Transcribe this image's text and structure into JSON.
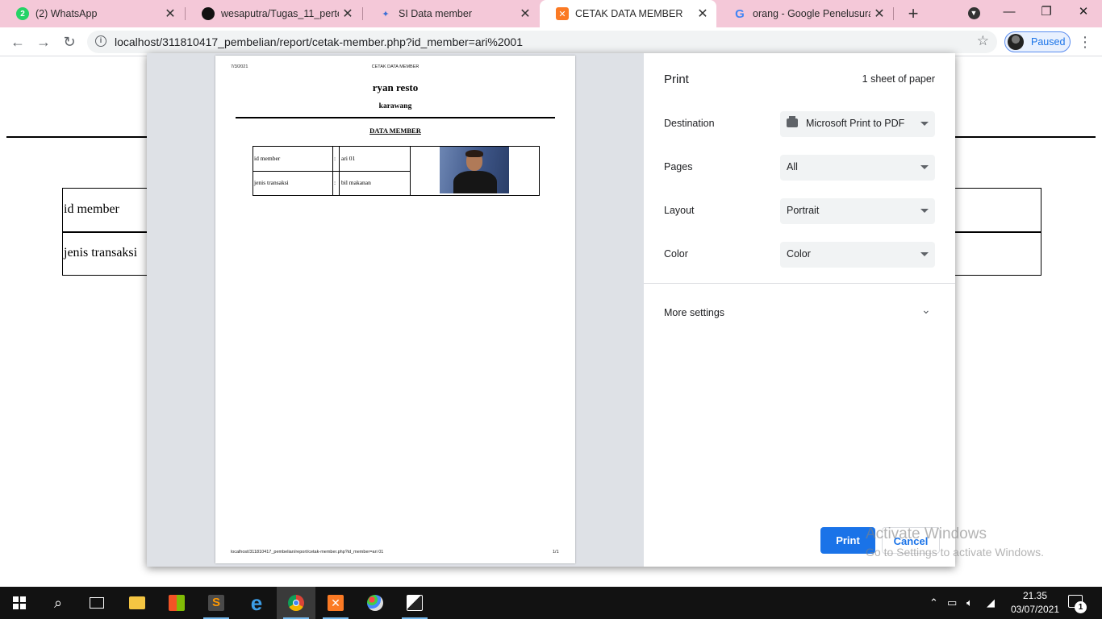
{
  "browser": {
    "tabs": [
      {
        "title": "(2) WhatsApp",
        "icon": "whatsapp-icon",
        "badge": "2"
      },
      {
        "title": "wesaputra/Tugas_11_pertemuan",
        "icon": "github-icon"
      },
      {
        "title": "SI Data member",
        "icon": "site-icon"
      },
      {
        "title": "CETAK DATA MEMBER",
        "icon": "xampp-icon",
        "active": true
      },
      {
        "title": "orang - Google Penelusuran",
        "icon": "google-icon"
      }
    ],
    "new_tab_symbol": "+",
    "url": "localhost/311810417_pembelian/report/cetak-member.php?id_member=ari%2001",
    "profile_status": "Paused"
  },
  "background_page": {
    "rows": [
      {
        "label": "id member"
      },
      {
        "label": "jenis transaksi"
      }
    ]
  },
  "print_preview": {
    "date": "7/3/2021",
    "header_title": "CETAK DATA MEMBER",
    "org_name": "ryan resto",
    "org_city": "karawang",
    "section_title": "DATA MEMBER",
    "rows": [
      {
        "label": "id member",
        "sep": ":",
        "value": "ari 01"
      },
      {
        "label": "jenis transaksi",
        "sep": ":",
        "value": "bil makanan"
      }
    ],
    "footer_url": "localhost/311810417_pembelian/report/cetak-member.php?id_member=ari 01",
    "page_num": "1/1"
  },
  "print_settings": {
    "title": "Print",
    "sheet_count": "1 sheet of paper",
    "destination": {
      "label": "Destination",
      "value": "Microsoft Print to PDF"
    },
    "pages": {
      "label": "Pages",
      "value": "All"
    },
    "layout": {
      "label": "Layout",
      "value": "Portrait"
    },
    "color": {
      "label": "Color",
      "value": "Color"
    },
    "more_settings": "More settings",
    "print_button": "Print",
    "cancel_button": "Cancel"
  },
  "watermark": {
    "line1": "Activate Windows",
    "line2": "Go to Settings to activate Windows."
  },
  "taskbar": {
    "time": "21.35",
    "date": "03/07/2021",
    "notification_count": "1"
  },
  "colors": {
    "tab_strip": "#f4c8d8",
    "accent": "#1a73e8",
    "taskbar": "#121212"
  }
}
